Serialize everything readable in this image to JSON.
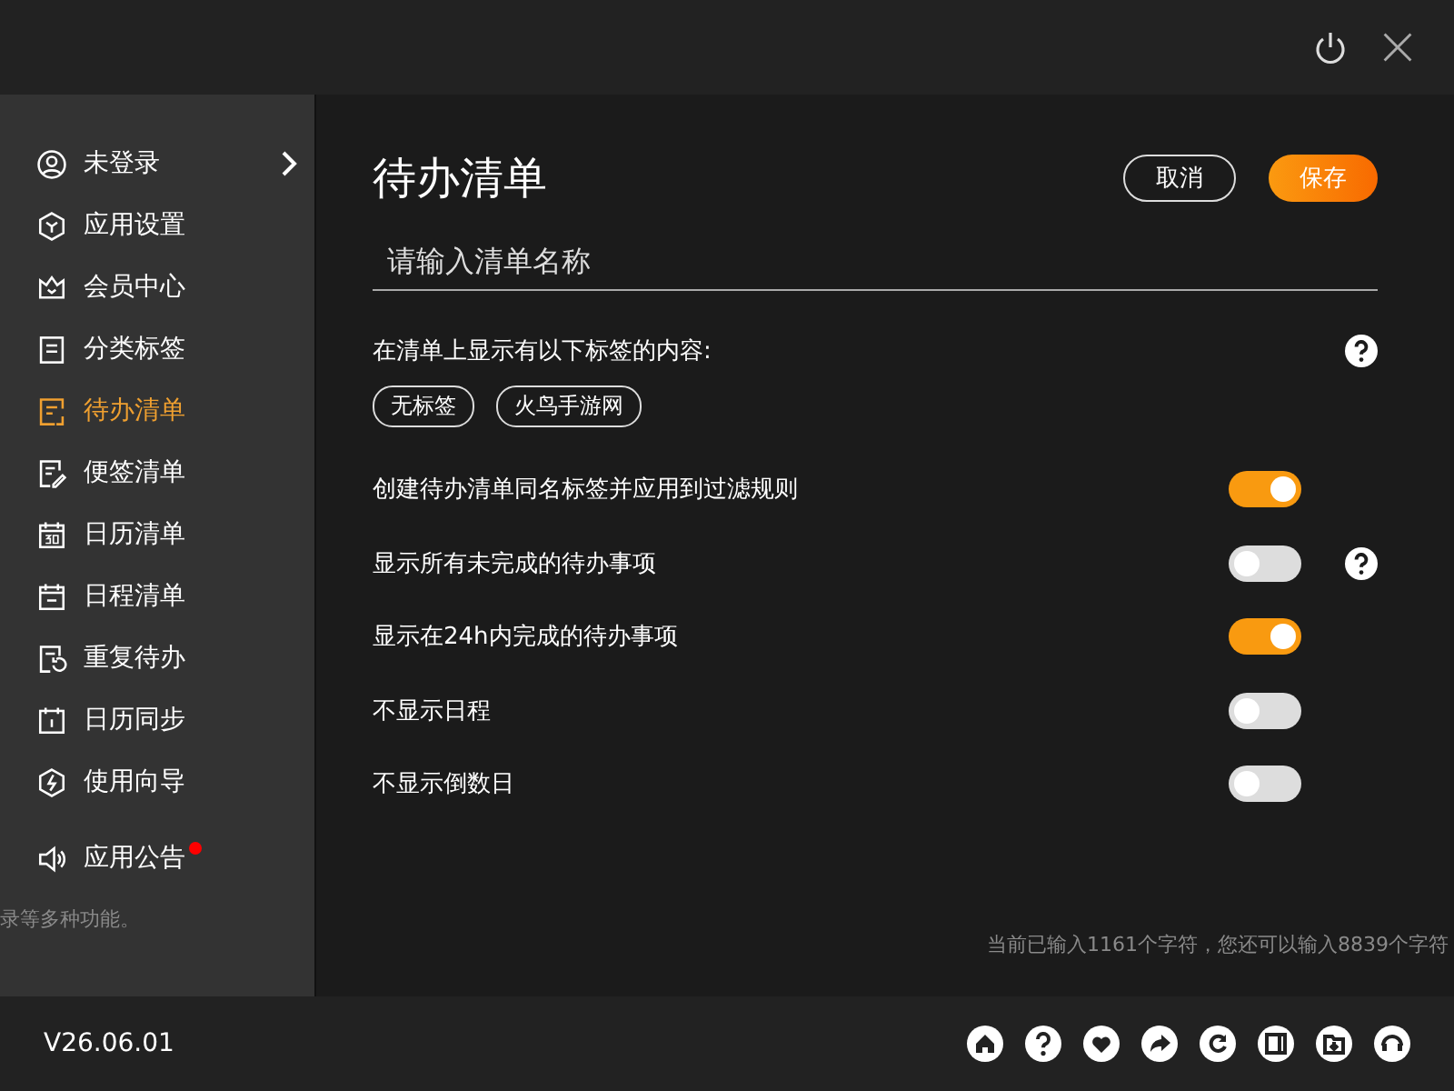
{
  "sidebar": {
    "items": [
      {
        "label": "未登录",
        "selected": false,
        "chevron": true
      },
      {
        "label": "应用设置",
        "selected": false
      },
      {
        "label": "会员中心",
        "selected": false
      },
      {
        "label": "分类标签",
        "selected": false
      },
      {
        "label": "待办清单",
        "selected": true
      },
      {
        "label": "便签清单",
        "selected": false
      },
      {
        "label": "日历清单",
        "selected": false
      },
      {
        "label": "日程清单",
        "selected": false
      },
      {
        "label": "重复待办",
        "selected": false
      },
      {
        "label": "日历同步",
        "selected": false
      },
      {
        "label": "使用向导",
        "selected": false
      },
      {
        "label": "应用公告",
        "selected": false,
        "badge": true
      }
    ]
  },
  "background_texts": [
    "录等多种功能。",
    "当前已输入1161个字符，您还可以输入8839个字符"
  ],
  "page": {
    "title": "待办清单",
    "buttons": [
      {
        "label": "取消",
        "kind": "outline"
      },
      {
        "label": "保存",
        "kind": "primary"
      }
    ],
    "name_field": {
      "placeholder": "请输入清单名称"
    },
    "tags_label": "在清单上显示有以下标签的内容:",
    "tags": [
      "无标签",
      "火鸟手游网"
    ],
    "options": [
      {
        "label": "创建待办清单同名标签并应用到过滤规则",
        "on": true,
        "help": false
      },
      {
        "label": "显示所有未完成的待办事项",
        "on": false,
        "help": true
      },
      {
        "label": "显示在24h内完成的待办事项",
        "on": true,
        "help": false
      },
      {
        "label": "不显示日程",
        "on": false,
        "help": false
      },
      {
        "label": "不显示倒数日",
        "on": false,
        "help": false
      }
    ]
  },
  "footer": {
    "version": "V26.06.01"
  }
}
